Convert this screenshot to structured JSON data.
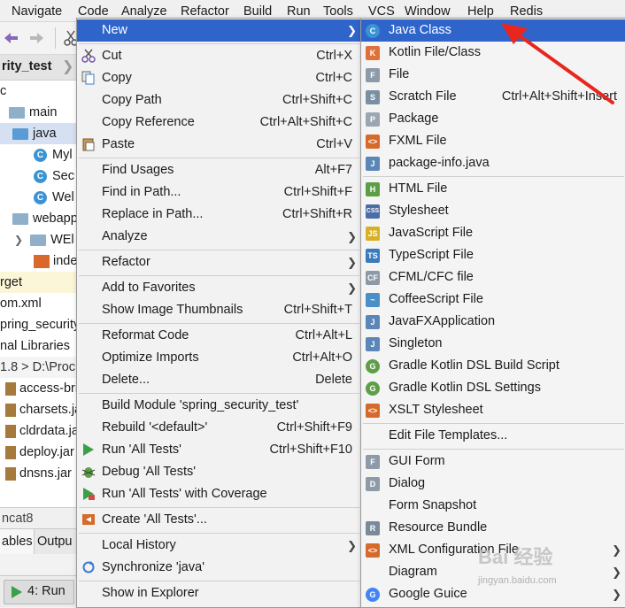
{
  "menubar": [
    "Navigate",
    "Code",
    "Analyze",
    "Refactor",
    "Build",
    "Run",
    "Tools",
    "VCS",
    "Window",
    "Help",
    "Redis"
  ],
  "toolbar": {
    "project_tab": "rity_test"
  },
  "tree": [
    {
      "label": "c",
      "icon": "none"
    },
    {
      "label": "main",
      "icon": "folder"
    },
    {
      "label": "java",
      "icon": "folder-blue",
      "selected": true
    },
    {
      "label": "Myl",
      "icon": "class"
    },
    {
      "label": "Sec",
      "icon": "class"
    },
    {
      "label": "Wel",
      "icon": "class"
    },
    {
      "label": "webapp",
      "icon": "folder"
    },
    {
      "label": "WEl",
      "icon": "folder"
    },
    {
      "label": "inde",
      "icon": "jsp"
    },
    {
      "label": "rget",
      "icon": "none"
    },
    {
      "label": "om.xml",
      "icon": "none"
    },
    {
      "label": "pring_security",
      "icon": "none"
    },
    {
      "label": "nal Libraries",
      "icon": "none"
    },
    {
      "label": "1.8 >  D:\\Proc",
      "icon": "none"
    },
    {
      "label": "access-brid",
      "icon": "jar"
    },
    {
      "label": "charsets.jar",
      "icon": "jar"
    },
    {
      "label": "cldrdata.jar",
      "icon": "jar"
    },
    {
      "label": "deploy.jar",
      "icon": "jar"
    },
    {
      "label": "dnsns.jar",
      "icon": "jar"
    }
  ],
  "bottom": {
    "tomcat": "ncat8",
    "tab1": "ables",
    "tab2": "Outpu",
    "run": "4: Run"
  },
  "menu1": {
    "items": [
      {
        "label": "New",
        "shortcut": "",
        "submenu": true,
        "selected": true,
        "icon": ""
      },
      {
        "sep": true
      },
      {
        "label": "Cut",
        "shortcut": "Ctrl+X",
        "icon": "cut"
      },
      {
        "label": "Copy",
        "shortcut": "Ctrl+C",
        "icon": "copy"
      },
      {
        "label": "Copy Path",
        "shortcut": "Ctrl+Shift+C",
        "icon": ""
      },
      {
        "label": "Copy Reference",
        "shortcut": "Ctrl+Alt+Shift+C",
        "icon": ""
      },
      {
        "label": "Paste",
        "shortcut": "Ctrl+V",
        "icon": "paste"
      },
      {
        "sep": true
      },
      {
        "label": "Find Usages",
        "shortcut": "Alt+F7",
        "icon": ""
      },
      {
        "label": "Find in Path...",
        "shortcut": "Ctrl+Shift+F",
        "icon": ""
      },
      {
        "label": "Replace in Path...",
        "shortcut": "Ctrl+Shift+R",
        "icon": ""
      },
      {
        "label": "Analyze",
        "shortcut": "",
        "submenu": true,
        "icon": ""
      },
      {
        "sep": true
      },
      {
        "label": "Refactor",
        "shortcut": "",
        "submenu": true,
        "icon": ""
      },
      {
        "sep": true
      },
      {
        "label": "Add to Favorites",
        "shortcut": "",
        "submenu": true,
        "icon": ""
      },
      {
        "label": "Show Image Thumbnails",
        "shortcut": "Ctrl+Shift+T",
        "icon": ""
      },
      {
        "sep": true
      },
      {
        "label": "Reformat Code",
        "shortcut": "Ctrl+Alt+L",
        "icon": ""
      },
      {
        "label": "Optimize Imports",
        "shortcut": "Ctrl+Alt+O",
        "icon": ""
      },
      {
        "label": "Delete...",
        "shortcut": "Delete",
        "icon": ""
      },
      {
        "sep": true
      },
      {
        "label": "Build Module 'spring_security_test'",
        "shortcut": "",
        "icon": ""
      },
      {
        "label": "Rebuild '<default>'",
        "shortcut": "Ctrl+Shift+F9",
        "icon": ""
      },
      {
        "label": "Run 'All Tests'",
        "shortcut": "Ctrl+Shift+F10",
        "icon": "run"
      },
      {
        "label": "Debug 'All Tests'",
        "shortcut": "",
        "icon": "debug"
      },
      {
        "label": "Run 'All Tests' with Coverage",
        "shortcut": "",
        "icon": "coverage"
      },
      {
        "sep": true
      },
      {
        "label": "Create 'All Tests'...",
        "shortcut": "",
        "icon": "create"
      },
      {
        "sep": true
      },
      {
        "label": "Local History",
        "shortcut": "",
        "submenu": true,
        "icon": ""
      },
      {
        "label": "Synchronize 'java'",
        "shortcut": "",
        "icon": "sync"
      },
      {
        "sep": true
      },
      {
        "label": "Show in Explorer",
        "shortcut": "",
        "icon": ""
      }
    ]
  },
  "menu2": {
    "items": [
      {
        "label": "Java Class",
        "shortcut": "",
        "selected": true,
        "icon": "C",
        "color": "#3a93d4"
      },
      {
        "label": "Kotlin File/Class",
        "shortcut": "",
        "icon": "K",
        "color": "#e0703a"
      },
      {
        "label": "File",
        "shortcut": "",
        "icon": "F",
        "color": "#8d9aa7"
      },
      {
        "label": "Scratch File",
        "shortcut": "Ctrl+Alt+Shift+Insert",
        "icon": "S",
        "color": "#7a8fa3"
      },
      {
        "label": "Package",
        "shortcut": "",
        "icon": "P",
        "color": "#9aa6b2"
      },
      {
        "label": "FXML File",
        "shortcut": "",
        "icon": "<>",
        "color": "#d66a2a"
      },
      {
        "label": "package-info.java",
        "shortcut": "",
        "icon": "J",
        "color": "#5a86b8"
      },
      {
        "sep": true
      },
      {
        "label": "HTML File",
        "shortcut": "",
        "icon": "H",
        "color": "#5c9e45"
      },
      {
        "label": "Stylesheet",
        "shortcut": "",
        "icon": "CSS",
        "color": "#4a6da8"
      },
      {
        "label": "JavaScript File",
        "shortcut": "",
        "icon": "JS",
        "color": "#d8b026"
      },
      {
        "label": "TypeScript File",
        "shortcut": "",
        "icon": "TS",
        "color": "#3a7bbd"
      },
      {
        "label": "CFML/CFC file",
        "shortcut": "",
        "icon": "CF",
        "color": "#8c9aa6"
      },
      {
        "label": "CoffeeScript File",
        "shortcut": "",
        "icon": "~",
        "color": "#4a8fc8"
      },
      {
        "label": "JavaFXApplication",
        "shortcut": "",
        "icon": "J",
        "color": "#5a86b8"
      },
      {
        "label": "Singleton",
        "shortcut": "",
        "icon": "J",
        "color": "#5a86b8"
      },
      {
        "label": "Gradle Kotlin DSL Build Script",
        "shortcut": "",
        "icon": "G",
        "color": "#5d9e46"
      },
      {
        "label": "Gradle Kotlin DSL Settings",
        "shortcut": "",
        "icon": "G",
        "color": "#5d9e46"
      },
      {
        "label": "XSLT Stylesheet",
        "shortcut": "",
        "icon": "<>",
        "color": "#d66a2a"
      },
      {
        "sep": true
      },
      {
        "label": "Edit File Templates...",
        "shortcut": "",
        "icon": "",
        "color": ""
      },
      {
        "sep": true
      },
      {
        "label": "GUI Form",
        "shortcut": "",
        "icon": "F",
        "color": "#8d9aa7"
      },
      {
        "label": "Dialog",
        "shortcut": "",
        "icon": "D",
        "color": "#8d9aa7"
      },
      {
        "label": "Form Snapshot",
        "shortcut": "",
        "icon": "",
        "color": ""
      },
      {
        "label": "Resource Bundle",
        "shortcut": "",
        "icon": "R",
        "color": "#7a8a98"
      },
      {
        "label": "XML Configuration File",
        "shortcut": "",
        "submenu": true,
        "icon": "<>",
        "color": "#d66a2a"
      },
      {
        "label": "Diagram",
        "shortcut": "",
        "submenu": true,
        "icon": "",
        "color": ""
      },
      {
        "label": "Google Guice",
        "shortcut": "",
        "submenu": true,
        "icon": "G",
        "color": "#4285f4"
      }
    ]
  },
  "watermark": {
    "main": "Bai  经验",
    "sub": "jingyan.baidu.com"
  }
}
